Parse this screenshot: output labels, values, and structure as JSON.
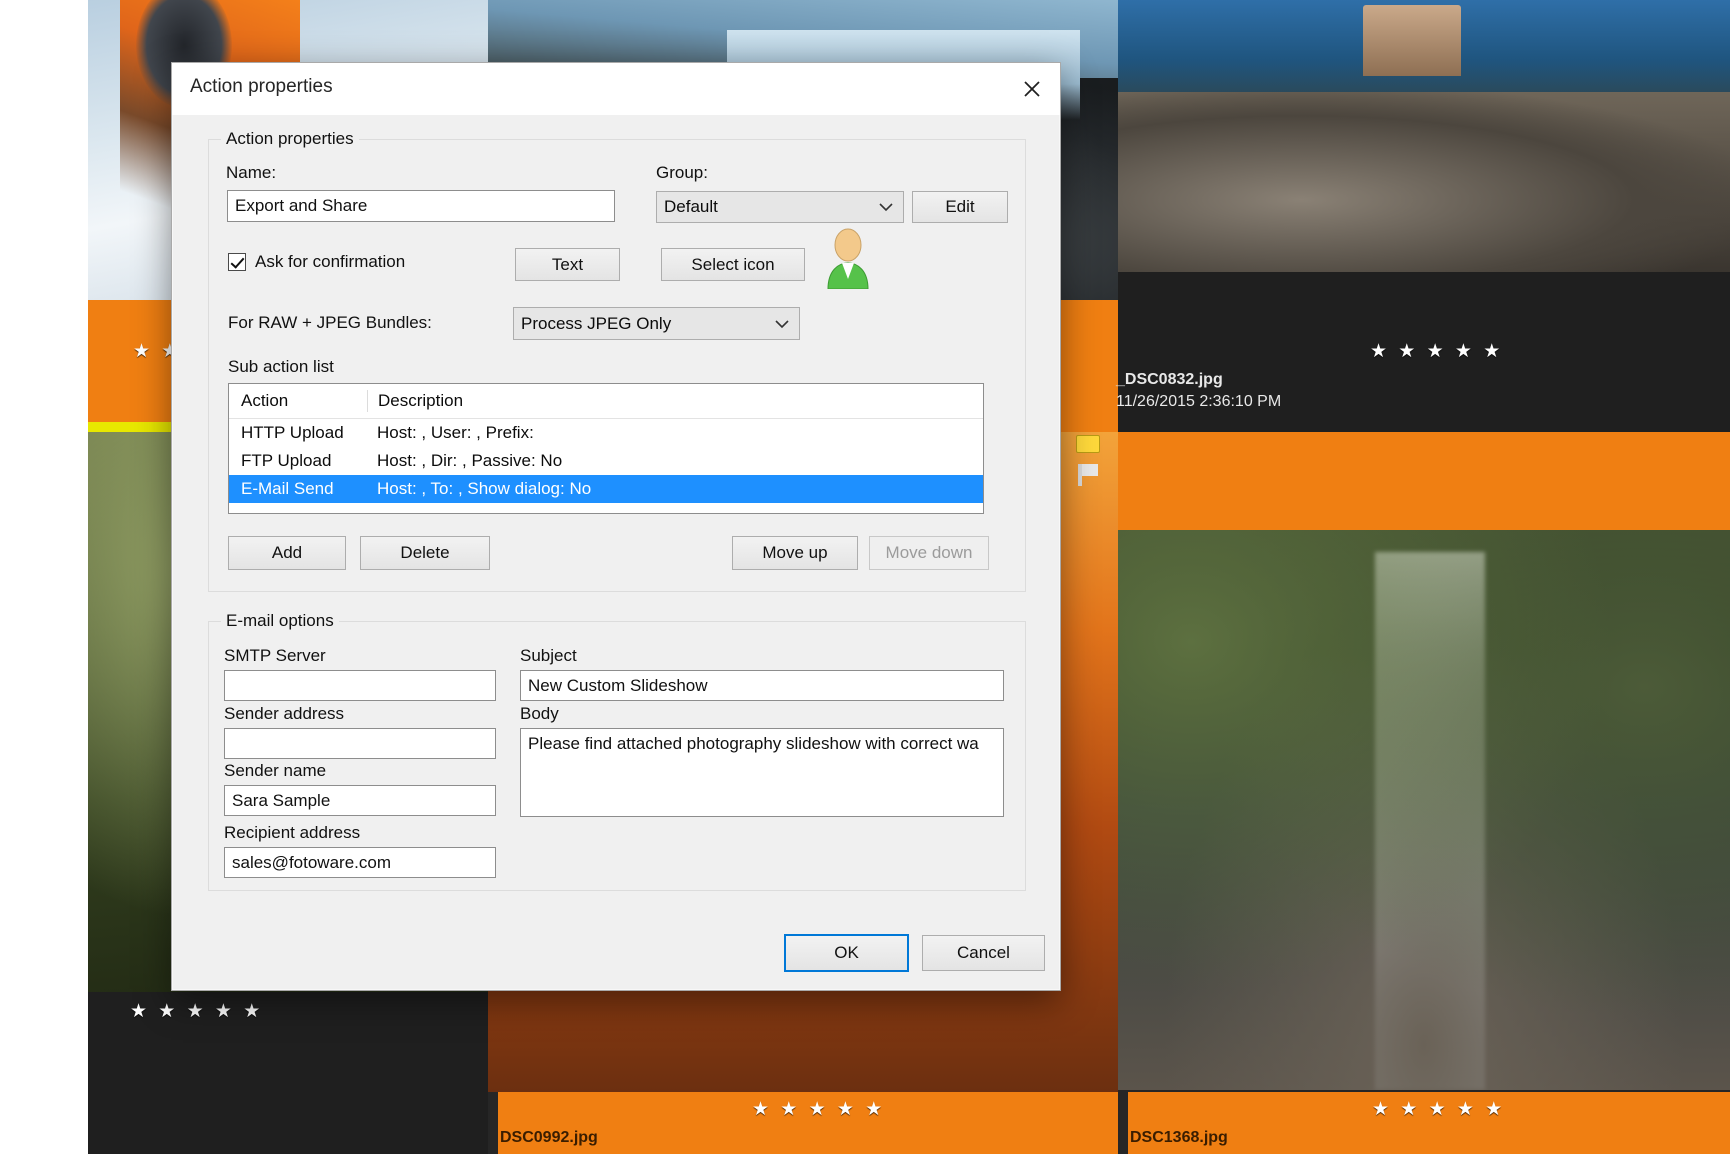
{
  "dialog": {
    "title": "Action properties",
    "close_icon": "close-icon",
    "groups": {
      "action_properties": "Action properties",
      "email_options": "E-mail options"
    },
    "labels": {
      "name": "Name:",
      "group": "Group:",
      "raw_jpeg": "For RAW + JPEG Bundles:",
      "sub_action_list": "Sub action list",
      "smtp_server": "SMTP Server",
      "sender_address": "Sender address",
      "sender_name": "Sender name",
      "recipient_address": "Recipient address",
      "subject": "Subject",
      "body": "Body"
    },
    "fields": {
      "name_value": "Export and Share",
      "group_value": "Default",
      "raw_jpeg_value": "Process JPEG Only",
      "smtp_server_value": "",
      "sender_address_value": "",
      "sender_name_value": "Sara Sample",
      "recipient_address_value": "sales@fotoware.com",
      "subject_value": "New Custom Slideshow",
      "body_value": "Please find attached photography slideshow with correct wa"
    },
    "checkbox": {
      "ask_for_confirmation": "Ask for confirmation",
      "checked": true
    },
    "buttons": {
      "edit": "Edit",
      "text": "Text",
      "select_icon": "Select icon",
      "add": "Add",
      "delete": "Delete",
      "move_up": "Move up",
      "move_down": "Move down",
      "move_down_disabled": true,
      "ok": "OK",
      "cancel": "Cancel"
    },
    "sub_action_list": {
      "columns": [
        "Action",
        "Description"
      ],
      "rows": [
        {
          "action": "HTTP Upload",
          "description": "Host: , User: , Prefix:",
          "selected": false
        },
        {
          "action": "FTP Upload",
          "description": "Host: , Dir: , Passive: No",
          "selected": false
        },
        {
          "action": "E-Mail Send",
          "description": "Host: , To: , Show dialog: No",
          "selected": true
        }
      ]
    },
    "colors": {
      "selection": "#1e90ff",
      "focus_border": "#0078d7",
      "dialog_bg": "#f0f0f0"
    }
  },
  "background": {
    "accent_orange": "#f07f12",
    "photos": [
      {
        "name": "_DSC0832.jpg",
        "date": "11/26/2015 2:36:10 PM",
        "rating": "★ ★ ★ ★ ★"
      },
      {
        "name": "DSC0992.jpg",
        "rating": "★ ★ ★ ★ ★"
      },
      {
        "name": "DSC1368.jpg",
        "rating": "★ ★ ★ ★ ★"
      }
    ],
    "left_rating": "★ ★",
    "bottom_left_rating": "★ ★ ★ ★ ★"
  }
}
